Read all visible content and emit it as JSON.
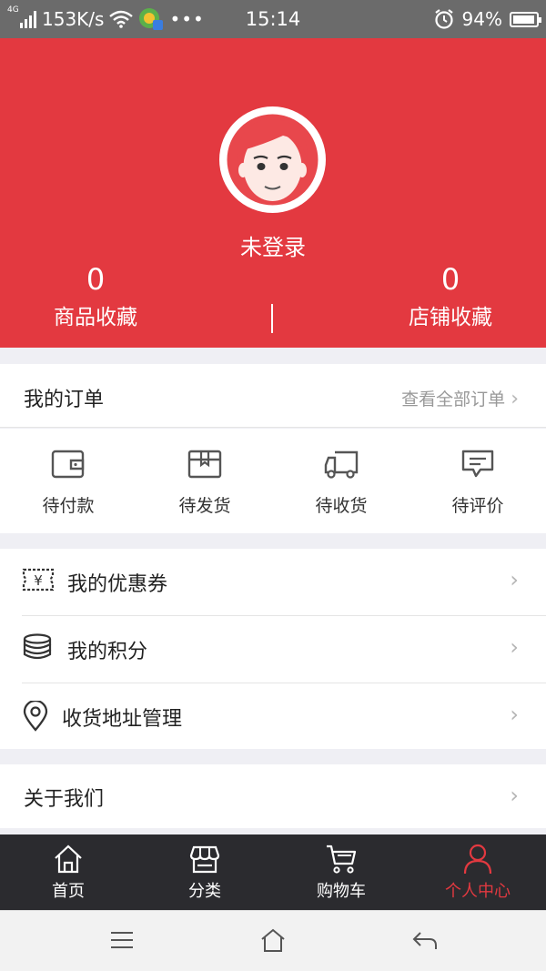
{
  "status_bar": {
    "network": "4G",
    "speed": "153K/s",
    "time": "15:14",
    "battery": "94%"
  },
  "profile": {
    "login_text": "未登录",
    "favorites_count": "0",
    "favorites_label": "商品收藏",
    "shops_count": "0",
    "shops_label": "店铺收藏"
  },
  "orders": {
    "title": "我的订单",
    "view_all": "查看全部订单",
    "items": [
      {
        "label": "待付款",
        "icon": "wallet-icon"
      },
      {
        "label": "待发货",
        "icon": "box-icon"
      },
      {
        "label": "待收货",
        "icon": "truck-icon"
      },
      {
        "label": "待评价",
        "icon": "comment-icon"
      }
    ]
  },
  "menu": {
    "items": [
      {
        "label": "我的优惠券",
        "icon": "coupon-icon"
      },
      {
        "label": "我的积分",
        "icon": "coins-icon"
      },
      {
        "label": "收货地址管理",
        "icon": "location-pin-icon"
      }
    ],
    "about": "关于我们"
  },
  "tabbar": {
    "items": [
      {
        "label": "首页",
        "icon": "home-icon"
      },
      {
        "label": "分类",
        "icon": "store-icon"
      },
      {
        "label": "购物车",
        "icon": "cart-icon"
      },
      {
        "label": "个人中心",
        "icon": "person-icon"
      }
    ],
    "active_index": 3
  },
  "colors": {
    "accent": "#e33940",
    "tabbar_bg": "#2b2b2f"
  }
}
